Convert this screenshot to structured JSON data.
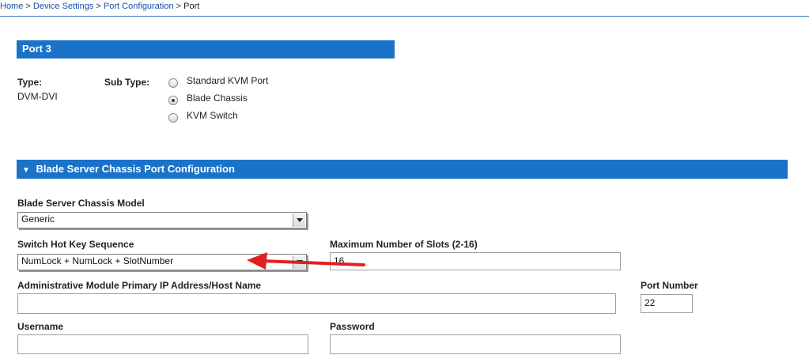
{
  "breadcrumb": {
    "home": "Home",
    "device_settings": "Device Settings",
    "port_configuration": "Port Configuration",
    "current": "Port",
    "separator": ">"
  },
  "port_panel": {
    "title": "Port 3",
    "type_label": "Type:",
    "type_value": "DVM-DVI",
    "subtype_label": "Sub Type:",
    "subtype_options": [
      "Standard KVM Port",
      "Blade Chassis",
      "KVM Switch"
    ],
    "subtype_selected": "Blade Chassis"
  },
  "blade_section": {
    "title": "Blade Server Chassis Port Configuration",
    "toggle_icon": "triangle-down-icon",
    "model_label": "Blade Server Chassis Model",
    "model_value": "Generic",
    "hotkey_label": "Switch Hot Key Sequence",
    "hotkey_value": "NumLock + NumLock + SlotNumber",
    "max_slots_label": "Maximum Number of Slots (2-16)",
    "max_slots_value": "16",
    "admin_ip_label": "Administrative Module Primary IP Address/Host Name",
    "admin_ip_value": "",
    "port_number_label": "Port Number",
    "port_number_value": "22",
    "username_label": "Username",
    "username_value": "",
    "password_label": "Password",
    "password_value": ""
  },
  "annotation": {
    "arrow_color": "#e02020",
    "icon": "red-arrow-icon"
  },
  "colors": {
    "section_bar": "#1a73c9",
    "link": "#1a4fa0"
  }
}
